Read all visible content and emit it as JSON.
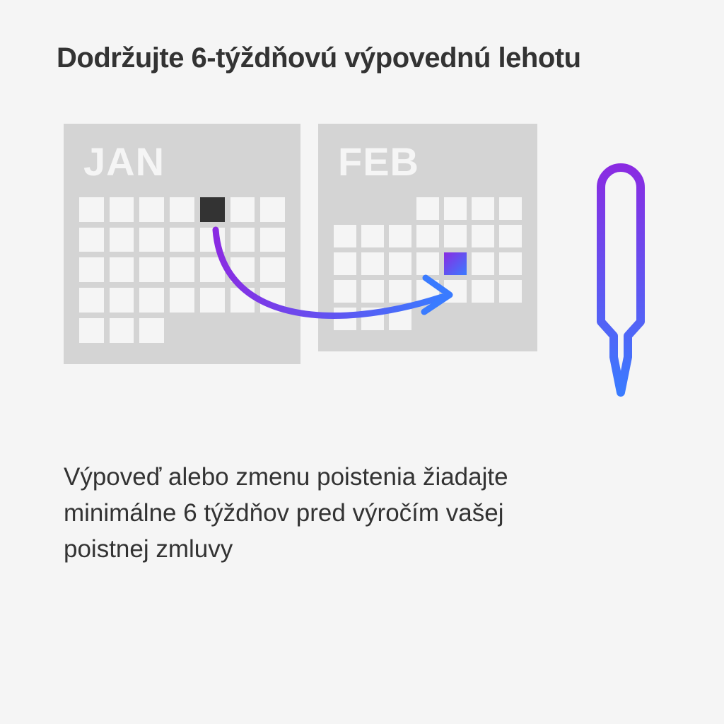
{
  "heading": "Dodržujte 6-týždňovú výpovednú lehotu",
  "body": "Výpoveď alebo zmenu poistenia žiadajte minimálne 6 týždňov pred výročím vašej poistnej zmluvy",
  "calendars": {
    "january": {
      "label": "JAN"
    },
    "february": {
      "label": "FEB"
    }
  },
  "colors": {
    "accent_purple": "#8a2be2",
    "accent_blue": "#3a7bff",
    "highlight_dark": "#333333",
    "calendar_bg": "#d4d4d4"
  }
}
